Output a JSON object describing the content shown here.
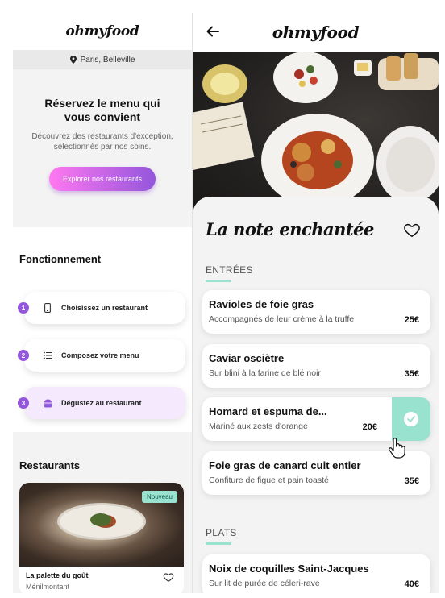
{
  "left": {
    "logo": "ohmyfood",
    "location": "Paris, Belleville",
    "hero": {
      "title": "Réservez le menu qui vous convient",
      "subtitle": "Découvrez des restaurants d'exception, sélectionnés par nos soins.",
      "button": "Explorer nos restaurants"
    },
    "how": {
      "title": "Fonctionnement",
      "steps": [
        {
          "num": "1",
          "label": "Choisissez un restaurant",
          "icon": "phone-icon"
        },
        {
          "num": "2",
          "label": "Composez votre menu",
          "icon": "list-icon"
        },
        {
          "num": "3",
          "label": "Dégustez au restaurant",
          "icon": "burger-icon"
        }
      ]
    },
    "restaurants": {
      "title": "Restaurants",
      "card": {
        "badge": "Nouveau",
        "name": "La palette du goût",
        "area": "Ménilmontant"
      }
    }
  },
  "right": {
    "logo": "ohmyfood",
    "restaurant": "La note enchantée",
    "sections": [
      {
        "title": "ENTRÉES",
        "dishes": [
          {
            "name": "Ravioles de foie gras",
            "desc": "Accompagnés de leur crème à la truffe",
            "price": "25€"
          },
          {
            "name": "Caviar osciètre",
            "desc": "Sur blini à la farine de blé noir",
            "price": "35€"
          },
          {
            "name": "Homard et espuma de...",
            "desc": "Mariné aux zests d'orange",
            "price": "20€",
            "selected": true
          },
          {
            "name": "Foie gras de canard cuit entier",
            "desc": "Confiture de figue et pain toasté",
            "price": "35€"
          }
        ]
      },
      {
        "title": "PLATS",
        "dishes": [
          {
            "name": "Noix de coquilles Saint-Jacques",
            "desc": "Sur lit de purée de céleri-rave",
            "price": "40€"
          }
        ]
      }
    ]
  },
  "colors": {
    "accent": "#99e2d0",
    "primary": "#9356dc",
    "gradient_start": "#ff78f0"
  }
}
